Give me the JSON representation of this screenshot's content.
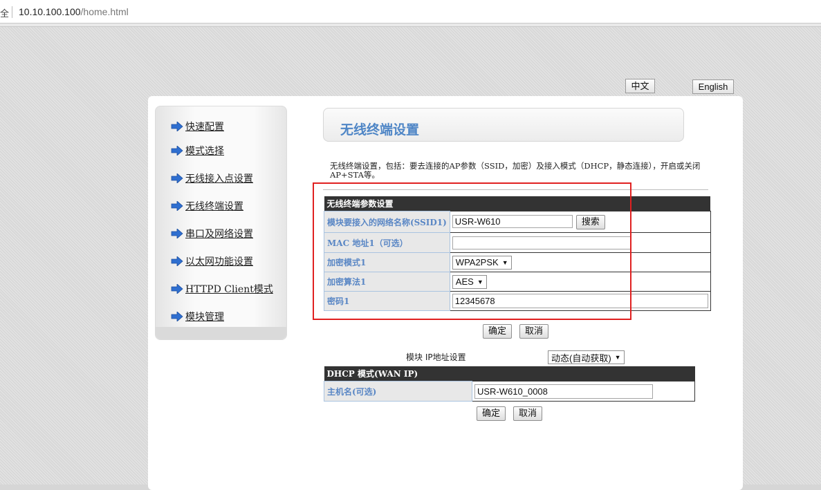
{
  "browser": {
    "security_label": "全",
    "url_host": "10.10.100.100",
    "url_path": "/home.html"
  },
  "lang": {
    "chinese": "中文",
    "english": "English"
  },
  "sidebar": {
    "items": [
      {
        "label": "快速配置"
      },
      {
        "label": "模式选择"
      },
      {
        "label": "无线接入点设置"
      },
      {
        "label": "无线终端设置"
      },
      {
        "label": "串口及网络设置"
      },
      {
        "label": "以太网功能设置"
      },
      {
        "label": "HTTPD Client模式"
      },
      {
        "label": "模块管理"
      }
    ]
  },
  "header": {
    "title": "无线终端设置"
  },
  "description": "无线终端设置，包括：要去连接的AP参数（SSID，加密）及接入模式（DHCP，静态连接），开启或关闭 AP+STA等。",
  "sta_params": {
    "section_title": "无线终端参数设置",
    "ssid_label": "模块要接入的网络名称(SSID1)",
    "ssid_value": "USR-W610",
    "search_button": "搜索",
    "mac_label": "MAC 地址1（可选）",
    "mac_value": "",
    "encryption_mode_label": "加密模式1",
    "encryption_mode_value": "WPA2PSK",
    "encryption_algo_label": "加密算法1",
    "encryption_algo_value": "AES",
    "password_label": "密码1",
    "password_value": "12345678"
  },
  "buttons1": {
    "ok": "确定",
    "cancel": "取消"
  },
  "ip_settings": {
    "label": "模块 IP地址设置",
    "mode_value": "动态(自动获取)"
  },
  "dhcp": {
    "section_title": "DHCP 模式(WAN IP)",
    "hostname_label": "主机名(可选)",
    "hostname_value": "USR-W610_0008"
  },
  "buttons2": {
    "ok": "确定",
    "cancel": "取消"
  },
  "colors": {
    "accent_blue": "#4f86c6",
    "highlight_red": "#e02020",
    "arrow_blue": "#2f6fd0"
  },
  "icons": {
    "nav_arrow": "arrow-right-icon"
  }
}
